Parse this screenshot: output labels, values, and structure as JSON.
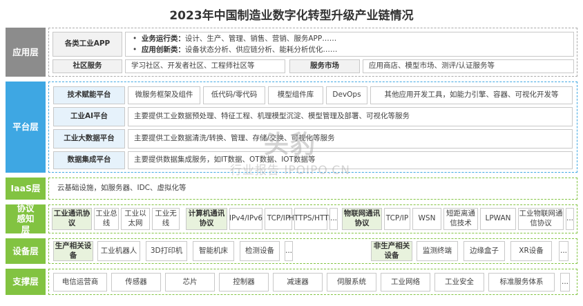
{
  "title": "2023年中国制造业数字化转型升级产业链情况",
  "layers": {
    "app": {
      "label": "应用层",
      "industrial_app": "各类工业APP",
      "biz_title": "业务运行类：",
      "biz_text": "设计、生产、管理、销售、营销、服务APP……",
      "inn_title": "应用创新类：",
      "inn_text": "设备状态分析、供应链分析、能耗分析优化……",
      "community": "社区服务",
      "community_items": "学习社区、开发者社区、工程师社区等",
      "market": "服务市场",
      "market_items": "应用商店、模型市场、测评/认证服务等"
    },
    "platform": {
      "label": "平台层",
      "tech": "技术赋能平台",
      "tech_items": [
        "微服务框架及组件",
        "低代码/零代码",
        "模型组件库",
        "DevOps",
        "其他应用开发工具，如能力引擎、容器、可视化开发等"
      ],
      "ai": "工业AI平台",
      "ai_text": "主要提供工业数据预处理、特征工程、机理模型沉淀、模型管理及部署、可视化等服务",
      "bigdata": "工业大数据平台",
      "bigdata_text": "主要提供工业数据清洗/转换、管理、存储/交换、可视化等服务",
      "integration": "数据集成平台",
      "integration_text": "主要提供数据集成服务，如IT数据、OT数据、IOT数据等"
    },
    "iaas": {
      "label": "IaaS层",
      "text": "云基础设施，如服务器、IDC、虚拟化等"
    },
    "protocol": {
      "label": "协议感知层",
      "group1": "工业通讯协议",
      "group1_items": [
        "工业总线",
        "工业以太网",
        "工业无线"
      ],
      "group2": "计算机通讯协议",
      "group2_items": [
        "IPv4/IPv6",
        "TCP/IP",
        "HTTPS/HTTP",
        "..."
      ],
      "group3": "物联网通讯协议",
      "group3_items": [
        "TCP/IP",
        "WSN",
        "短距离通信技术",
        "LPWAN",
        "工业物联网通信协议",
        "..."
      ]
    },
    "device": {
      "label": "设备层",
      "prod": "生产相关设备",
      "prod_items": [
        "工业机器人",
        "3D打印机",
        "智能机床",
        "检测设备",
        "..."
      ],
      "nonprod": "非生产相关设备",
      "nonprod_items": [
        "监测终端",
        "边缘盒子",
        "XR设备",
        "..."
      ]
    },
    "support": {
      "label": "支撑层",
      "items": [
        "电信运营商",
        "传感器",
        "芯片",
        "控制器",
        "减速器",
        "伺服系统",
        "工业网络",
        "工业安全",
        "标准服务体系",
        "..."
      ]
    }
  },
  "watermark": {
    "brand": "头豹",
    "site": "行业报告 IPOIPO.CN"
  }
}
